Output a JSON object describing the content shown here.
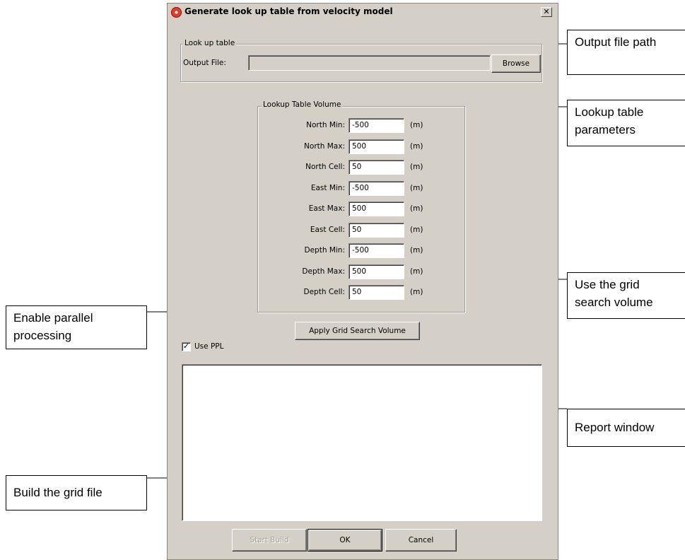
{
  "dialog": {
    "title": "Generate look up table from velocity model",
    "close_glyph": "✕",
    "lookup_group": {
      "legend": "Look up table",
      "output_label": "Output File:",
      "output_value": "",
      "browse_label": "Browse"
    },
    "volume_group": {
      "legend": "Lookup Table Volume",
      "rows": [
        {
          "label": "North Min:",
          "value": "-500",
          "unit": "(m)"
        },
        {
          "label": "North Max:",
          "value": "500",
          "unit": "(m)"
        },
        {
          "label": "North Cell:",
          "value": "50",
          "unit": "(m)"
        },
        {
          "label": "East Min:",
          "value": "-500",
          "unit": "(m)"
        },
        {
          "label": "East Max:",
          "value": "500",
          "unit": "(m)"
        },
        {
          "label": "East Cell:",
          "value": "50",
          "unit": "(m)"
        },
        {
          "label": "Depth Min:",
          "value": "-500",
          "unit": "(m)"
        },
        {
          "label": "Depth Max:",
          "value": "500",
          "unit": "(m)"
        },
        {
          "label": "Depth Cell:",
          "value": "50",
          "unit": "(m)"
        }
      ]
    },
    "apply_grid_label": "Apply Grid Search Volume",
    "use_ppl": {
      "label": "Use PPL",
      "checked": true,
      "check_glyph": "✓"
    },
    "report_text": "",
    "buttons": {
      "start_build": "Start Build",
      "ok": "OK",
      "cancel": "Cancel"
    }
  },
  "callouts": {
    "output_file": "Output file path",
    "lookup_params": "Lookup table parameters",
    "grid_search": "Use the grid search volume",
    "report": "Report window",
    "parallel": "Enable parallel processing",
    "build": "Build the grid file"
  }
}
